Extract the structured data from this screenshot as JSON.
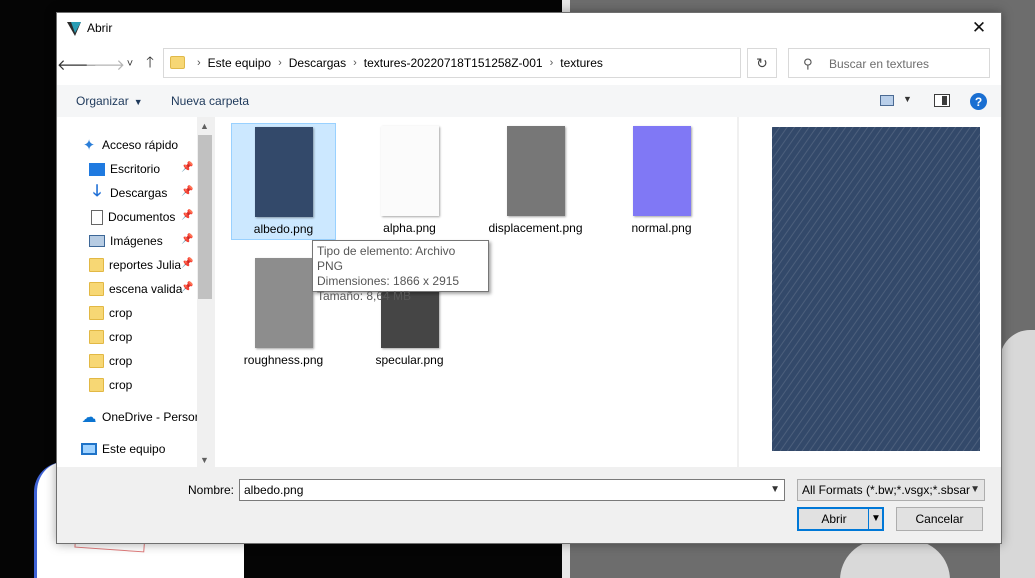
{
  "window": {
    "title": "Abrir",
    "close_glyph": "✕"
  },
  "nav": {
    "back": "🡐",
    "forward": "🡒",
    "recent": "˅",
    "up": "🡑",
    "breadcrumbs": [
      "Este equipo",
      "Descargas",
      "textures-20220718T151258Z-001",
      "textures"
    ],
    "separator": "›",
    "refresh": "↻",
    "search_placeholder": "Buscar en textures",
    "search_glyph": "⚲"
  },
  "toolbar": {
    "organize_label": "Organizar",
    "new_folder_label": "Nueva carpeta",
    "help_glyph": "?"
  },
  "sidebar": {
    "items": [
      {
        "label": "Acceso rápido",
        "icon": "star-icon",
        "glyph": "✦",
        "pinned": false
      },
      {
        "label": "Escritorio",
        "icon": "desktop-icon",
        "pinned": true
      },
      {
        "label": "Descargas",
        "icon": "download-icon",
        "glyph": "🡓",
        "pinned": true
      },
      {
        "label": "Documentos",
        "icon": "document-icon",
        "pinned": true
      },
      {
        "label": "Imágenes",
        "icon": "image-icon",
        "pinned": true
      },
      {
        "label": "reportes Julia",
        "icon": "folder-icon",
        "pinned": true
      },
      {
        "label": "escena valida",
        "icon": "folder-icon",
        "pinned": true
      },
      {
        "label": "crop",
        "icon": "folder-icon",
        "pinned": false
      },
      {
        "label": "crop",
        "icon": "folder-icon",
        "pinned": false
      },
      {
        "label": "crop",
        "icon": "folder-icon",
        "pinned": false
      },
      {
        "label": "crop",
        "icon": "folder-icon",
        "pinned": false
      },
      {
        "label": "OneDrive - Persor",
        "icon": "cloud-icon",
        "glyph": "☁",
        "pinned": false
      },
      {
        "label": "Este equipo",
        "icon": "computer-icon",
        "pinned": false
      }
    ],
    "pin_glyph": "📌"
  },
  "files": [
    {
      "name": "albedo.png",
      "color": "#33496a",
      "selected": true
    },
    {
      "name": "alpha.png",
      "color": "#fbfbfb",
      "selected": false
    },
    {
      "name": "displacement.png",
      "color": "#777777",
      "selected": false
    },
    {
      "name": "normal.png",
      "color": "#8078f5",
      "selected": false
    },
    {
      "name": "roughness.png",
      "color": "#8d8d8d",
      "selected": false
    },
    {
      "name": "specular.png",
      "color": "#454545",
      "selected": false
    }
  ],
  "tooltip": {
    "type": "Tipo de elemento: Archivo PNG",
    "dimensions": "Dimensiones: 1866 x 2915",
    "size": "Tamaño: 8,64 MB"
  },
  "preview": {
    "color": "#33496a"
  },
  "footer": {
    "name_label": "Nombre:",
    "name_value": "albedo.png",
    "format_value": "All Formats (*.bw;*.vsgx;*.sbsar",
    "open_label": "Abrir",
    "cancel_label": "Cancelar"
  }
}
